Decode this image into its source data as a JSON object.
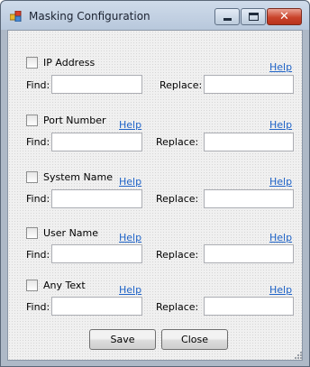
{
  "window": {
    "title": "Masking Configuration",
    "close_glyph": "✕",
    "icons": [
      "app-icon",
      "minimize-icon",
      "maximize-icon",
      "close-icon",
      "resize-grip-icon"
    ]
  },
  "sections": [
    {
      "label": "IP Address",
      "help": "Help",
      "find_label": "Find:",
      "replace_label": "Replace:",
      "checked": false,
      "find_value": "",
      "replace_value": ""
    },
    {
      "label": "Port Number",
      "help": "Help",
      "find_label": "Find:",
      "replace_label": "Replace:",
      "checked": false,
      "find_value": "",
      "replace_value": ""
    },
    {
      "label": "System Name",
      "help": "Help",
      "find_label": "Find:",
      "replace_label": "Replace:",
      "checked": false,
      "find_value": "",
      "replace_value": ""
    },
    {
      "label": "User Name",
      "help": "Help",
      "find_label": "Find:",
      "replace_label": "Replace:",
      "checked": false,
      "find_value": "",
      "replace_value": ""
    },
    {
      "label": "Any Text",
      "help": "Help",
      "find_label": "Find:",
      "replace_label": "Replace:",
      "checked": false,
      "find_value": "",
      "replace_value": ""
    }
  ],
  "buttons": {
    "save": "Save",
    "close": "Close"
  },
  "colors": {
    "link": "#1f63c7",
    "close_button": "#c9432b",
    "titlebar": "#b8c8dc"
  }
}
